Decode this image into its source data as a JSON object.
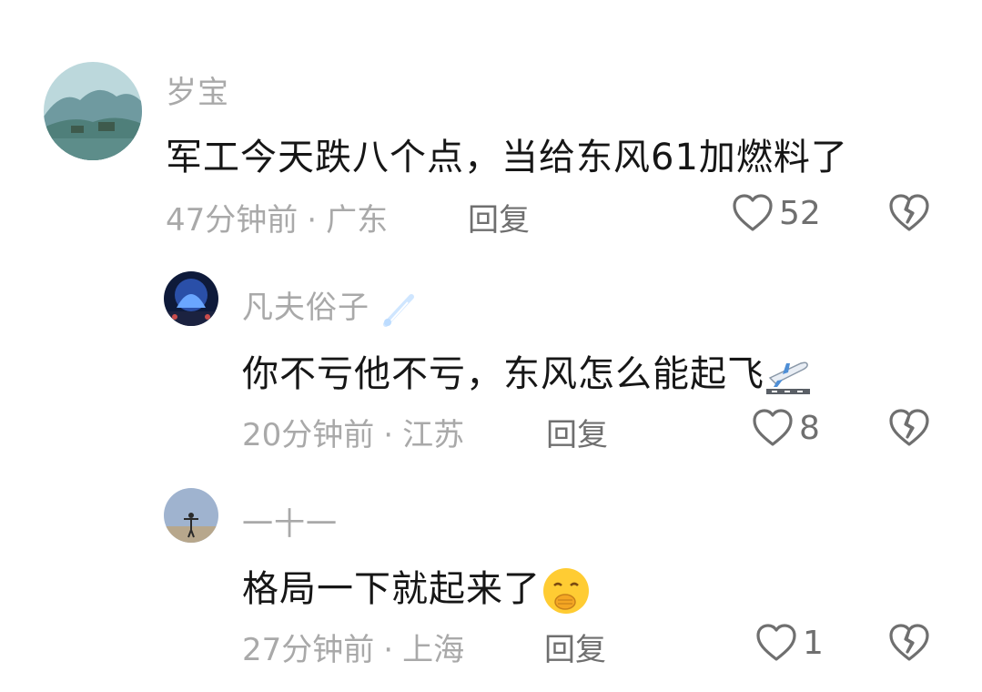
{
  "comments": [
    {
      "username": "岁宝",
      "content": "军工今天跌八个点，当给东风61加燃料了",
      "time": "47分钟前",
      "location": "广东",
      "reply_label": "回复",
      "likes": "52"
    },
    {
      "username": "凡夫俗子",
      "content": "你不亏他不亏，东风怎么能起飞",
      "time": "20分钟前",
      "location": "江苏",
      "reply_label": "回复",
      "likes": "8"
    },
    {
      "username": "一十一",
      "content": "格局一下就起来了",
      "time": "27分钟前",
      "location": "上海",
      "reply_label": "回复",
      "likes": "1"
    }
  ],
  "separator": "·",
  "colors": {
    "secondary_text": "#a9a9a9",
    "primary_text": "#161616",
    "action_text": "#6f6f6f"
  }
}
